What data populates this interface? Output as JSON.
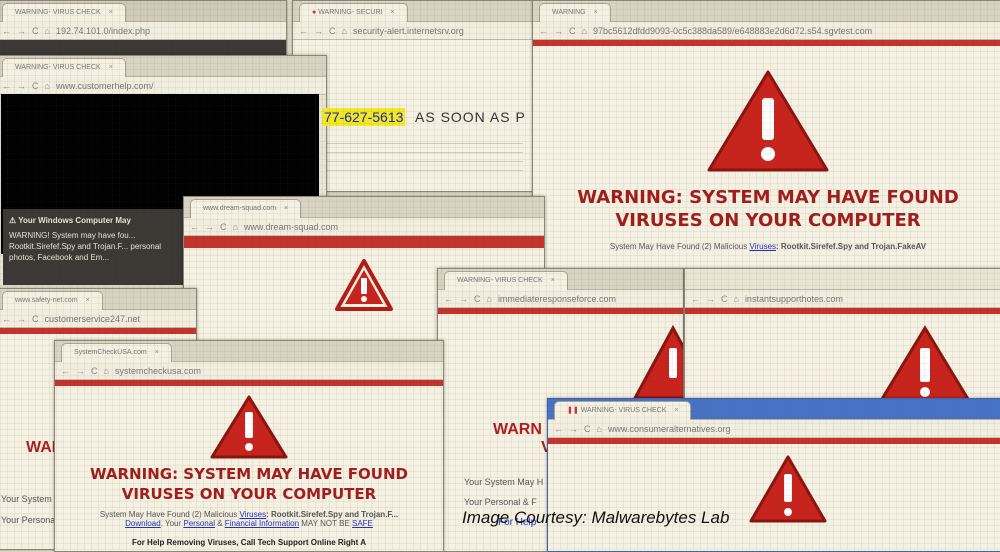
{
  "credit": "Image Courtesy: Malwarebytes Lab",
  "phone_fragment": "77-627-5613",
  "asap_fragment": "AS SOON AS P",
  "warning_title_line1": "WARNING: SYSTEM MAY HAVE FOUND",
  "warning_title_line2": "VIRUSES ON YOUR COMPUTER",
  "windows": {
    "w1": {
      "tab": "WARNING- VIRUS CHECK",
      "url": "192.74.101.0/index.php"
    },
    "w2": {
      "tab": "WARNING- SECURI",
      "url": "security-alert.internetsrv.org"
    },
    "w3": {
      "tab": "WARNING- VIRUS CHECK",
      "url": "www.customerhelp.com/"
    },
    "w4": {
      "tab": "WARNING",
      "url": "97bc5612dfdd9093-0c5c388da589/e648883e2d6d72.s54.sgvtest.com"
    },
    "w5": {
      "tab": "www.dream-squad.com",
      "url": "www.dream-squad.com"
    },
    "w6": {
      "tab": "WARNING- VIRUS CHECK",
      "url": "immediateresponseforce.com"
    },
    "w7": {
      "tab": "",
      "url": "instantsupporthotes.com"
    },
    "w8": {
      "tab": "www.safety-net.com",
      "url": "customerservice247.net"
    },
    "w9": {
      "tab": "SystemCheckUSA.com",
      "url": "systemcheckusa.com"
    },
    "w10": {
      "tab": "WARNING- VIRUS CHECK",
      "url": "www.consumeralternatives.org"
    }
  },
  "w4_body": {
    "line_start": "System May Have Found (2) Malicious",
    "viruses": "Viruses",
    "line_end": ": Rootkit.Sirefef.Spy and Trojan.FakeAV"
  },
  "w9_body": {
    "line1_start": "System May Have Found (2) Malicious",
    "viruses": "Viruses",
    "line1_end": ": Rootkit.Sirefef.Spy and Trojan.F...",
    "download": "Download",
    "your": ". Your",
    "personal": "Personal",
    "amp": "&",
    "financial": "Financial Information",
    "may_not": "MAY NOT BE",
    "safe": "SAFE",
    "line3": "For Help Removing Viruses, Call Tech Support Online Right A"
  },
  "dark_dialog": {
    "title": "Your Windows Computer May",
    "text": "WARNING! System may have fou... Rootkit.Sirefef.Spy and Trojan.F... personal photos, Facebook and Em..."
  },
  "partial_text": {
    "warn_left": "WARN",
    "warn_mid": "WARN",
    "warn_mid2": "VIR",
    "your_system_left": "Your System",
    "your_personal_left": "Your Persona",
    "your_system_mid": "Your System May H",
    "your_personal_mid": "Your Personal & F",
    "for_help_mid": "For Help"
  },
  "colors": {
    "warning_red": "#a11d1d",
    "red_bar": "#c4332c",
    "phone_highlight": "#f3ea23",
    "link_blue": "#2233bb"
  }
}
